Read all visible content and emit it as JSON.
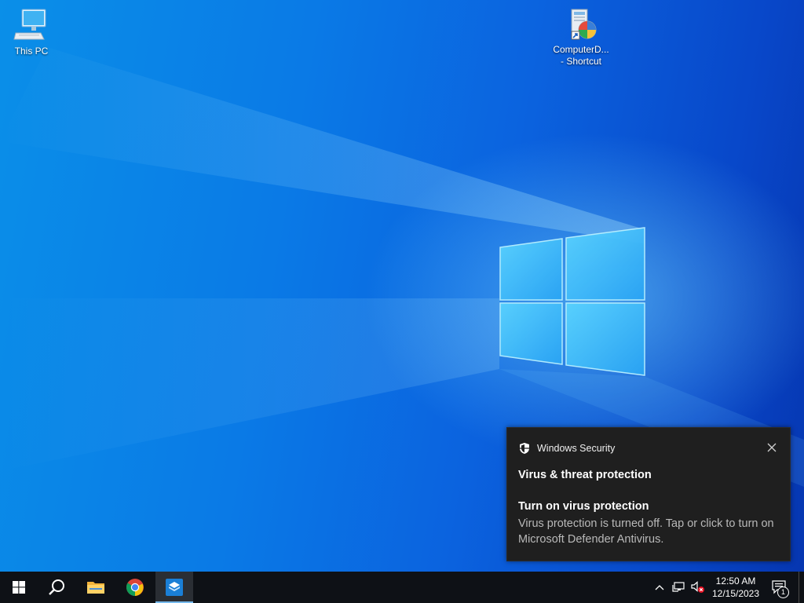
{
  "desktop": {
    "icons": [
      {
        "label": "This PC",
        "icon": "computer-icon"
      },
      {
        "label_line1": "ComputerD...",
        "label_line2": "- Shortcut",
        "icon": "control-panel-shortcut-icon"
      }
    ],
    "wallpaper": "windows-10-hero-blue",
    "accent": "#0a7ae6"
  },
  "toast": {
    "app_name": "Windows Security",
    "app_icon": "shield-icon",
    "heading": "Virus & threat protection",
    "title": "Turn on virus protection",
    "body": "Virus protection is turned off. Tap or click to turn on Microsoft Defender Antivirus.",
    "close_icon": "close-icon",
    "background": "#1f1f1f"
  },
  "taskbar": {
    "items": [
      {
        "name": "start",
        "icon": "windows-logo-icon"
      },
      {
        "name": "search",
        "icon": "search-icon"
      },
      {
        "name": "file-explorer",
        "icon": "folder-icon"
      },
      {
        "name": "chrome",
        "icon": "chrome-icon"
      },
      {
        "name": "windows-sandbox",
        "icon": "app-box-icon",
        "active": true
      }
    ],
    "tray": {
      "chevron_icon": "chevron-up-icon",
      "network_icon": "network-icon",
      "volume_icon": "volume-muted-icon",
      "time": "12:50 AM",
      "date": "12/15/2023",
      "notification_count": "1",
      "notification_icon": "action-center-icon"
    }
  }
}
